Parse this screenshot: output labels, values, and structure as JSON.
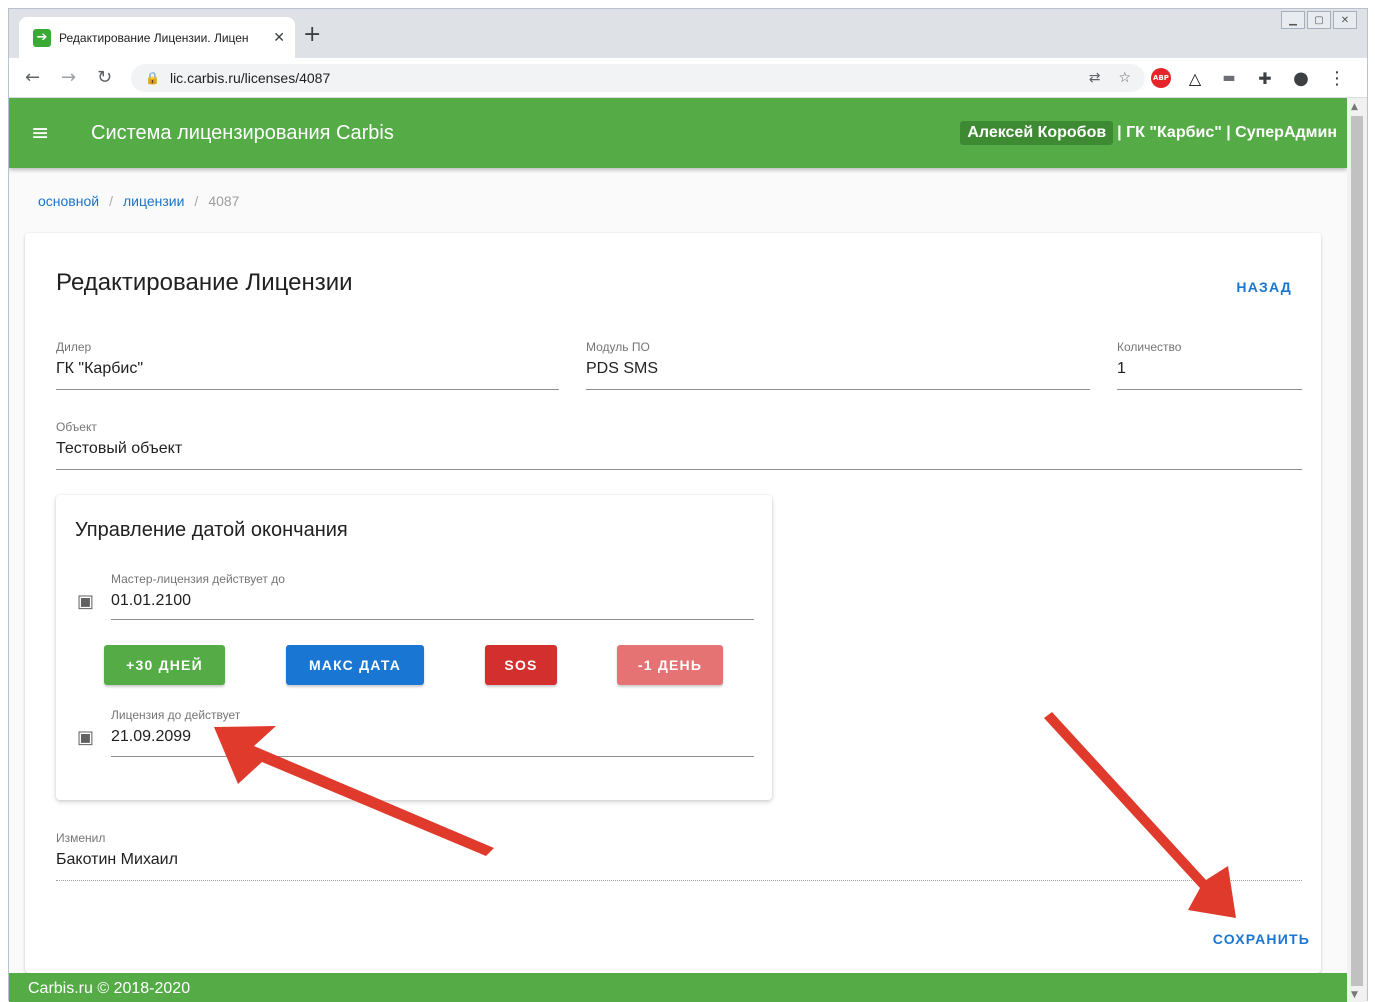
{
  "browser": {
    "tab_title": "Редактирование Лицензии. Лицен",
    "url": "lic.carbis.ru/licenses/4087"
  },
  "appbar": {
    "title": "Система лицензирования Carbis",
    "user_name": "Алексей Коробов",
    "user_rest": "| ГК \"Карбис\" | СуперАдмин"
  },
  "breadcrumb": [
    {
      "label": "основной"
    },
    {
      "label": "лицензии"
    },
    {
      "label": "4087"
    }
  ],
  "card": {
    "title": "Редактирование Лицензии",
    "back_label": "НАЗАД",
    "dealer": {
      "label": "Дилер",
      "value": "ГК \"Карбис\""
    },
    "module": {
      "label": "Модуль ПО",
      "value": "PDS SMS"
    },
    "quantity": {
      "label": "Количество",
      "value": "1"
    },
    "object": {
      "label": "Объект",
      "value": "Тестовый объект"
    },
    "modified_by": {
      "label": "Изменил",
      "value": "Бакотин Михаил"
    },
    "save_label": "СОХРАНИТЬ"
  },
  "date_panel": {
    "title": "Управление датой окончания",
    "master": {
      "label": "Мастер-лицензия действует до",
      "value": "01.01.2100"
    },
    "license": {
      "label": "Лицензия до действует",
      "value": "21.09.2099"
    },
    "buttons": {
      "plus30": "+30 ДНЕЙ",
      "max": "МАКС ДАТА",
      "sos": "SOS",
      "minus1": "-1 ДЕНЬ"
    }
  },
  "footer": {
    "text": "Carbis.ru © 2018-2020"
  },
  "colors": {
    "green": "#55ac47",
    "blue": "#1976d2",
    "red": "#d32f2f",
    "light_red": "#e57373",
    "annotation_arrow": "#e03a2c"
  }
}
